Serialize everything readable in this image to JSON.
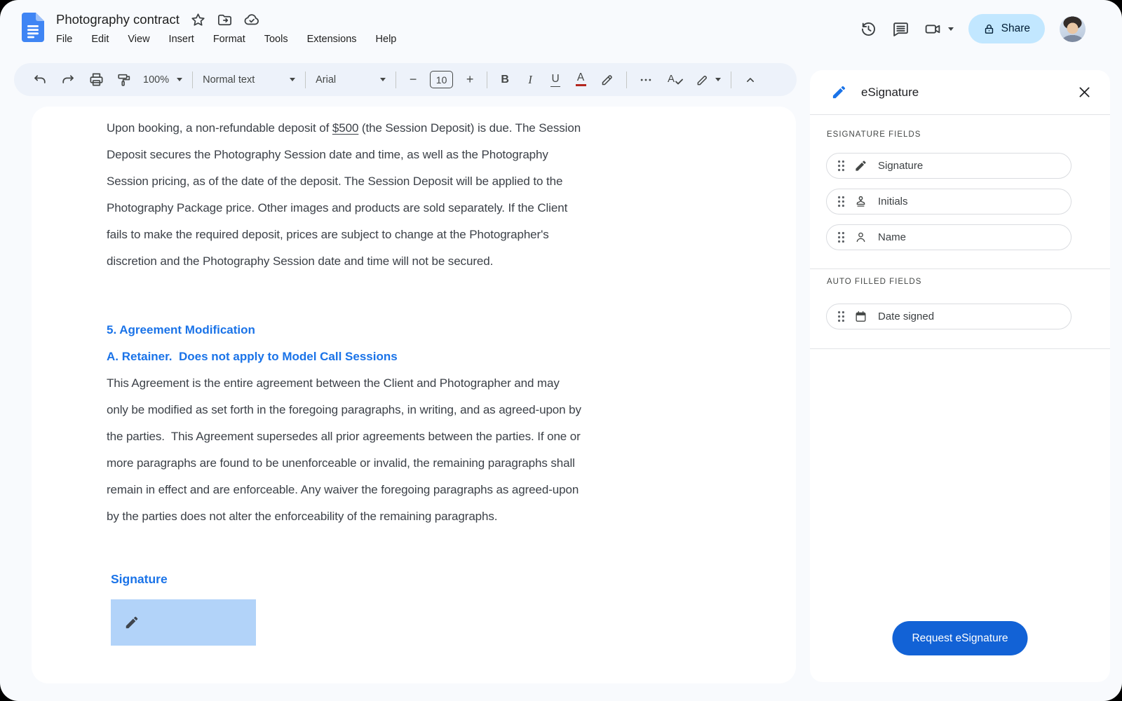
{
  "titlebar": {
    "title": "Photography contract",
    "menus": [
      "File",
      "Edit",
      "View",
      "Insert",
      "Format",
      "Tools",
      "Extensions",
      "Help"
    ],
    "share_label": "Share"
  },
  "toolbar": {
    "zoom_value": "100%",
    "styles_value": "Normal text",
    "font_value": "Arial",
    "font_size_value": "10",
    "minus": "−",
    "plus": "+",
    "bold": "B",
    "italic": "I",
    "underline": "U",
    "text_color": "A",
    "spellcheck": "A"
  },
  "document": {
    "p1": {
      "l1_pre": "Upon booking, a non-refundable deposit of ",
      "l1_underline": "$500",
      "l1_post": " (the Session Deposit) is due. The Session",
      "lines": [
        "Deposit secures the Photography Session date and time, as well as the Photography",
        "Session pricing, as of the date of the deposit. The Session Deposit will be applied to the",
        "Photography Package price. Other images and products are sold separately. If the Client",
        "fails to make the required deposit, prices are subject to change at the Photographer's",
        "discretion and the Photography Session date and time will not be secured."
      ]
    },
    "heading1": "5. Agreement Modification",
    "heading2": "A. Retainer.  Does not apply to Model Call Sessions",
    "p2_lines": [
      "This Agreement is the entire agreement between the Client and Photographer and may",
      "only be modified as set forth in the foregoing paragraphs, in writing, and as agreed-upon by",
      "the parties.  This Agreement supersedes all prior agreements between the parties. If one or",
      "more paragraphs are found to be unenforceable or invalid, the remaining paragraphs shall",
      "remain in effect and are enforceable. Any waiver the foregoing paragraphs as agreed-upon",
      "by the parties does not alter the enforceability of the remaining paragraphs."
    ],
    "signature_heading": "Signature"
  },
  "panel": {
    "title": "eSignature",
    "esig_section_label": "ESIGNATURE FIELDS",
    "esig_fields": [
      {
        "label": "Signature",
        "icon": "pen-icon"
      },
      {
        "label": "Initials",
        "icon": "stamp-icon"
      },
      {
        "label": "Name",
        "icon": "person-icon"
      }
    ],
    "auto_section_label": "AUTO FILLED FIELDS",
    "auto_fields": [
      {
        "label": "Date signed",
        "icon": "calendar-icon"
      }
    ],
    "request_button": "Request eSignature"
  },
  "colors": {
    "accent_blue": "#1262d6",
    "heading_blue": "#1a73e8",
    "share_bg": "#c2e7ff",
    "signature_field_bg": "#b2d3f9",
    "toolbar_bg": "#edf2fa",
    "window_bg": "#f8fafd"
  }
}
